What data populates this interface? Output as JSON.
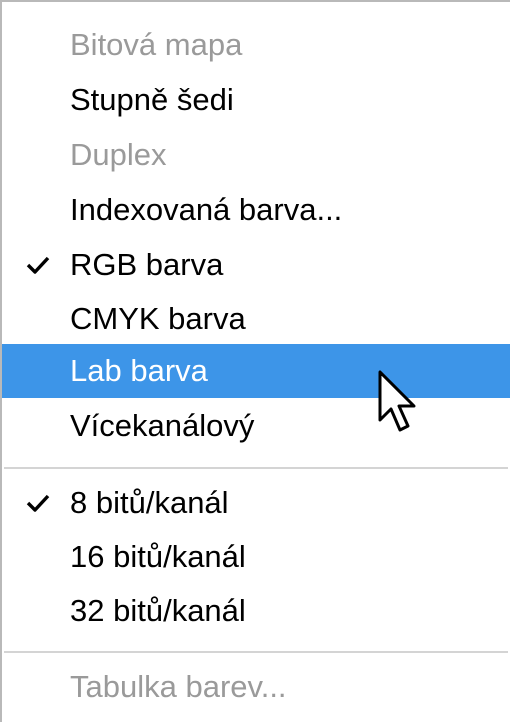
{
  "menu": {
    "items": [
      {
        "label": "Bitová mapa",
        "enabled": false,
        "checked": false,
        "highlighted": false
      },
      {
        "label": "Stupně šedi",
        "enabled": true,
        "checked": false,
        "highlighted": false
      },
      {
        "label": "Duplex",
        "enabled": false,
        "checked": false,
        "highlighted": false
      },
      {
        "label": "Indexovaná barva...",
        "enabled": true,
        "checked": false,
        "highlighted": false
      },
      {
        "label": "RGB barva",
        "enabled": true,
        "checked": true,
        "highlighted": false
      },
      {
        "label": "CMYK barva",
        "enabled": true,
        "checked": false,
        "highlighted": false
      },
      {
        "label": "Lab barva",
        "enabled": true,
        "checked": false,
        "highlighted": true
      },
      {
        "label": "Vícekanálový",
        "enabled": true,
        "checked": false,
        "highlighted": false
      },
      {
        "label": "8 bitů/kanál",
        "enabled": true,
        "checked": true,
        "highlighted": false
      },
      {
        "label": "16 bitů/kanál",
        "enabled": true,
        "checked": false,
        "highlighted": false
      },
      {
        "label": "32 bitů/kanál",
        "enabled": true,
        "checked": false,
        "highlighted": false
      },
      {
        "label": "Tabulka barev...",
        "enabled": false,
        "checked": false,
        "highlighted": false
      }
    ],
    "colors": {
      "highlight": "#3d95e8",
      "disabled_text": "#9a9a9a",
      "separator": "#d4d4d4"
    },
    "icons": {
      "check": "checkmark-icon",
      "cursor": "mouse-pointer-icon"
    }
  }
}
